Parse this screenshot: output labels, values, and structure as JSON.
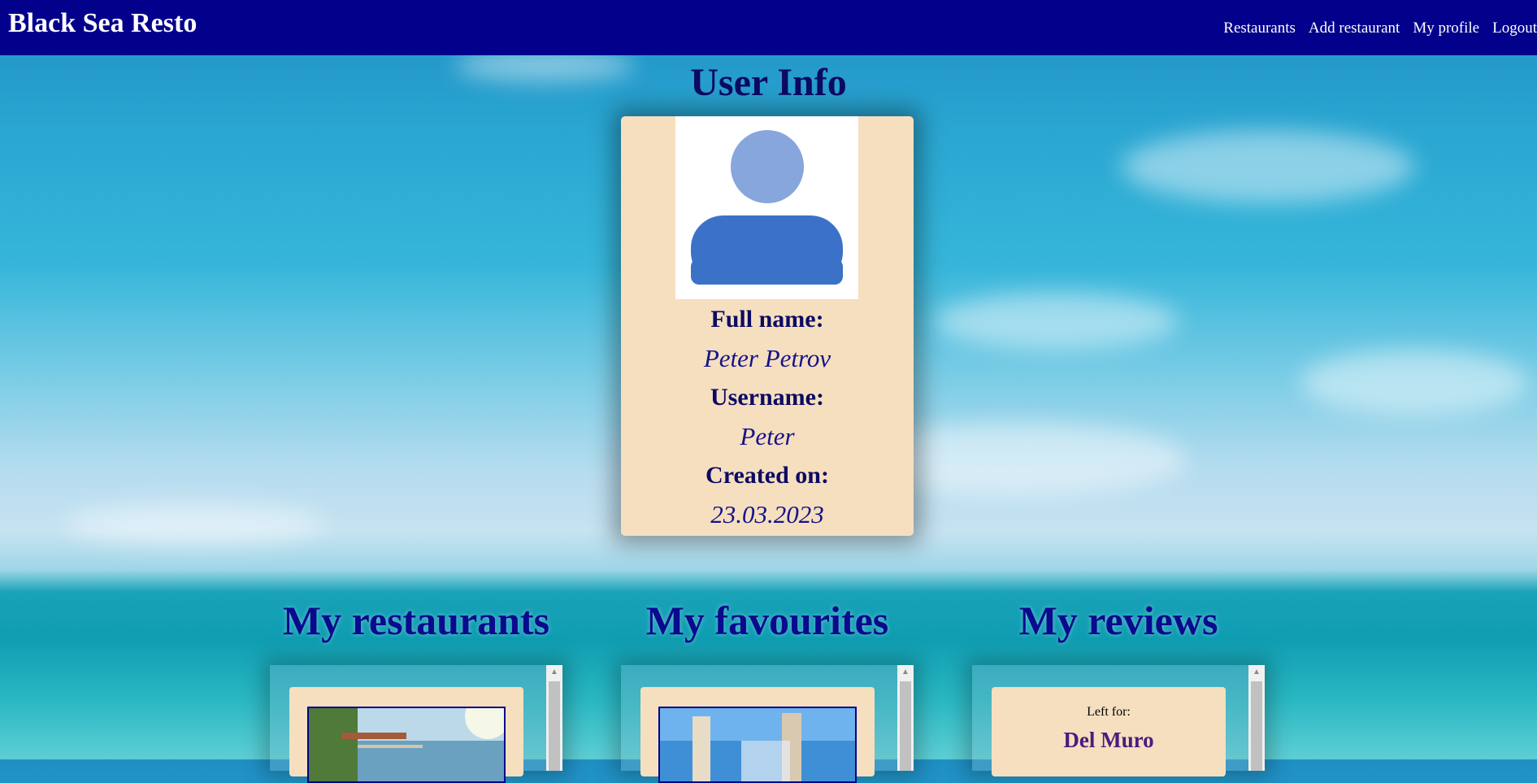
{
  "header": {
    "brand": "Black Sea Resto",
    "nav": [
      {
        "label": "Restaurants"
      },
      {
        "label": "Add restaurant"
      },
      {
        "label": "My profile"
      },
      {
        "label": "Logout"
      }
    ]
  },
  "user_info": {
    "title": "User Info",
    "avatar_icon": "user-avatar-icon",
    "full_name_label": "Full name:",
    "full_name": "Peter Petrov",
    "username_label": "Username:",
    "username": "Peter",
    "created_label": "Created on:",
    "created": "23.03.2023"
  },
  "sections": {
    "my_restaurants": {
      "title": "My restaurants"
    },
    "my_favourites": {
      "title": "My favourites"
    },
    "my_reviews": {
      "title": "My reviews",
      "items": [
        {
          "left_for_label": "Left for:",
          "restaurant": "Del Muro"
        }
      ]
    }
  },
  "colors": {
    "nav_bg": "#03008b",
    "card_bg": "#f5dfbf",
    "heading": "#0c0a63",
    "review_name": "#4b1b7e"
  }
}
